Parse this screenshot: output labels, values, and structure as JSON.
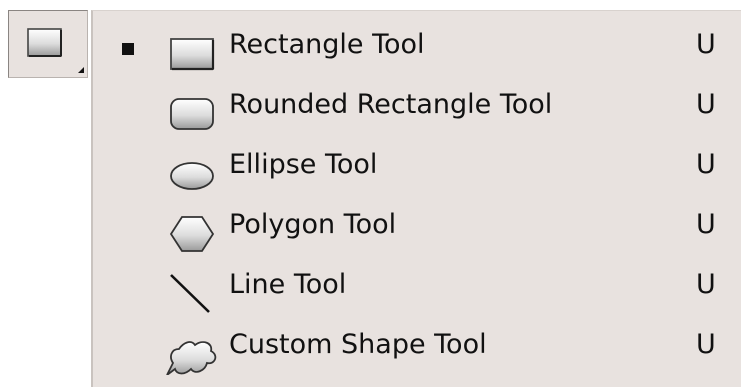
{
  "tool_button": {
    "icon": "rectangle-icon"
  },
  "menu": {
    "items": [
      {
        "label": "Rectangle Tool",
        "shortcut": "U",
        "icon": "rectangle-icon",
        "selected": true
      },
      {
        "label": "Rounded Rectangle Tool",
        "shortcut": "U",
        "icon": "rounded-rectangle-icon",
        "selected": false
      },
      {
        "label": "Ellipse Tool",
        "shortcut": "U",
        "icon": "ellipse-icon",
        "selected": false
      },
      {
        "label": "Polygon Tool",
        "shortcut": "U",
        "icon": "polygon-icon",
        "selected": false
      },
      {
        "label": "Line Tool",
        "shortcut": "U",
        "icon": "line-icon",
        "selected": false
      },
      {
        "label": "Custom Shape Tool",
        "shortcut": "U",
        "icon": "custom-shape-icon",
        "selected": false
      }
    ]
  },
  "colors": {
    "menu_background": "#e8e2df",
    "text": "#111111"
  }
}
